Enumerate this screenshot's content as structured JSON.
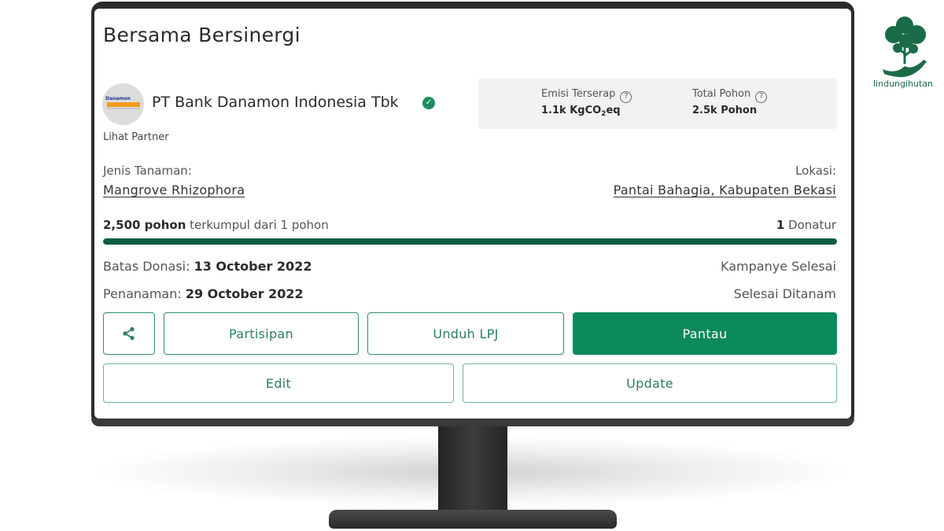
{
  "card": {
    "title": "Bersama Bersinergi",
    "partner": {
      "name": "PT Bank Danamon Indonesia Tbk",
      "logo_text": "Danamon",
      "link_label": "Lihat Partner"
    },
    "stats": {
      "emisi_label": "Emisi Terserap",
      "emisi_value_prefix": "1.1k KgCO",
      "emisi_value_sub": "2",
      "emisi_value_suffix": "eq",
      "pohon_label": "Total Pohon",
      "pohon_value": "2.5k Pohon",
      "help_glyph": "?"
    },
    "jenis_label": "Jenis Tanaman:",
    "jenis_value": "Mangrove Rhizophora",
    "lokasi_label": "Lokasi:",
    "lokasi_value": "Pantai Bahagia, Kabupaten Bekasi",
    "progress": {
      "collected_bold": "2,500 pohon",
      "collected_rest": " terkumpul dari 1 pohon",
      "donor_count": "1",
      "donor_label": " Donatur",
      "fill_fraction": 1.0,
      "color": "#0b5e43"
    },
    "batas_label": "Batas Donasi: ",
    "batas_value": "13 October 2022",
    "batas_status": "Kampanye Selesai",
    "tanam_label": "Penanaman: ",
    "tanam_value": "29 October 2022",
    "tanam_status": "Selesai Ditanam",
    "buttons": {
      "share_icon": "share-icon",
      "partisipan": "Partisipan",
      "unduh": "Unduh LPJ",
      "pantau": "Pantau",
      "edit": "Edit",
      "update": "Update"
    }
  },
  "brand": {
    "name": "lindungihutan",
    "color": "#1a6b48"
  },
  "colors": {
    "accent": "#0c8a5a",
    "outline": "#2f8f63"
  }
}
